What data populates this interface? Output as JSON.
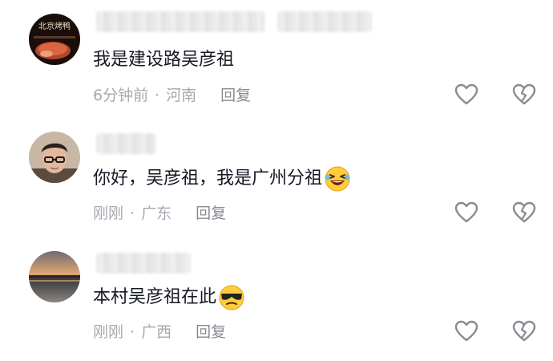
{
  "comments": [
    {
      "text": "我是建设路吴彦祖",
      "time": "6分钟前",
      "location": "河南",
      "reply_label": "回复",
      "emoji": ""
    },
    {
      "text": "你好，吴彦祖，我是广州分祖",
      "time": "刚刚",
      "location": "广东",
      "reply_label": "回复",
      "emoji": "laughing-emoji"
    },
    {
      "text": "本村吴彦祖在此",
      "time": "刚刚",
      "location": "广西",
      "reply_label": "回复",
      "emoji": "sunglasses-emoji"
    }
  ],
  "avatar_labels": {
    "first": "北京烤鸭"
  },
  "separator": "·",
  "colors": {
    "text": "#161823",
    "meta": "#a7a9b0",
    "icon": "#8a8b91"
  }
}
